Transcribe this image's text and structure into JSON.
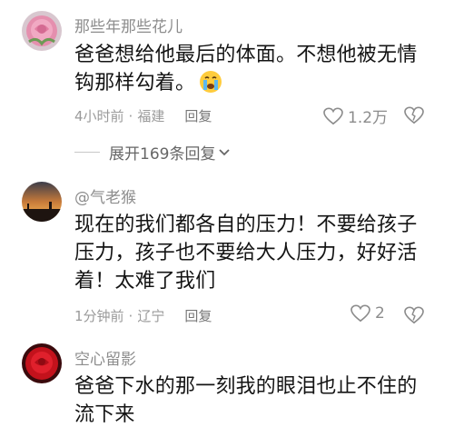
{
  "comments": [
    {
      "username": "那些年那些花儿",
      "text_line1": "爸爸想给他最后的体面。不想他被无情",
      "text_line2": "钩那样勾着。",
      "emoji": "crying-face",
      "time": "4小时前",
      "location": "福建",
      "reply_label": "回复",
      "likes": "1.2万",
      "expand_label": "展开169条回复"
    },
    {
      "username": "@气老猴",
      "text_line1": "现在的我们都各自的压力！不要给孩子",
      "text_line2": "压力，孩子也不要给大人压力，好好活",
      "text_line3": "着！太难了我们",
      "time": "1分钟前",
      "location": "辽宁",
      "reply_label": "回复",
      "likes": "2"
    },
    {
      "username": "空心留影",
      "text_line1": "爸爸下水的那一刻我的眼泪也止不住的",
      "text_line2": "流下来"
    }
  ],
  "separator": "·",
  "colors": {
    "text": "#141414",
    "meta": "#9a9a9a",
    "username": "#8d8d8d"
  }
}
